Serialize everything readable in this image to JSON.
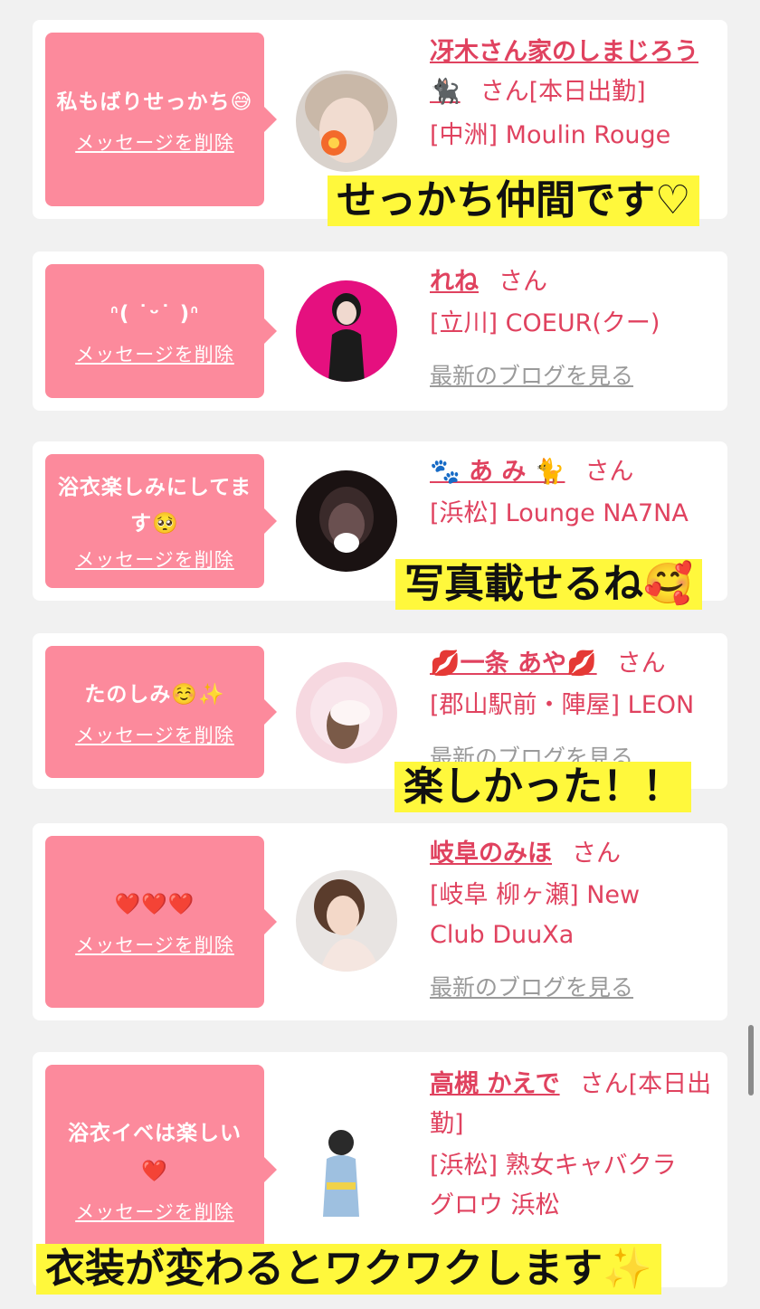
{
  "items": [
    {
      "message": "私もばりせっかち😅",
      "delete_label": "メッセージを削除",
      "name": "冴木さん家のしまじろう🐈‍⬛",
      "san": "さん[本日出勤]",
      "shop": "[中洲] Moulin Rouge",
      "blog": "",
      "caption": "せっかち仲間です♡"
    },
    {
      "message": "ᐢ( ˙ᵕ˙ )ᐢ",
      "delete_label": "メッセージを削除",
      "name": "れね",
      "san": "さん",
      "shop": "[立川] COEUR(クー)",
      "blog": "最新のブログを見る",
      "caption": ""
    },
    {
      "message": "浴衣楽しみにしてます🥺",
      "delete_label": "メッセージを削除",
      "name": "🐾 あ み 🐈",
      "san": "さん",
      "shop": "[浜松] Lounge NA7NA",
      "blog": "",
      "caption": "写真載せるね🥰"
    },
    {
      "message": "たのしみ☺️✨",
      "delete_label": "メッセージを削除",
      "name": "💋一条 あや💋",
      "san": "さん",
      "shop": "[郡山駅前・陣屋] LEON",
      "blog": "最新のブログを見る",
      "caption": "楽しかった！！"
    },
    {
      "message": "❤️❤️❤️",
      "delete_label": "メッセージを削除",
      "name": "岐阜のみほ",
      "san": "さん",
      "shop": "[岐阜 柳ヶ瀬] New Club DuuXa",
      "blog": "最新のブログを見る",
      "caption": ""
    },
    {
      "message": "浴衣イベは楽しい❤️",
      "delete_label": "メッセージを削除",
      "name": "高槻 かえで",
      "san": "さん[本日出勤]",
      "shop": "[浜松] 熟女キャバクラ グロウ 浜松",
      "blog": "",
      "caption": "衣装が変わるとワクワクします✨"
    }
  ],
  "colors": {
    "bubble": "#fc8a9c",
    "accent": "#e0425f",
    "caption_bg": "#fff83c",
    "page_bg": "#f1f1f1"
  }
}
